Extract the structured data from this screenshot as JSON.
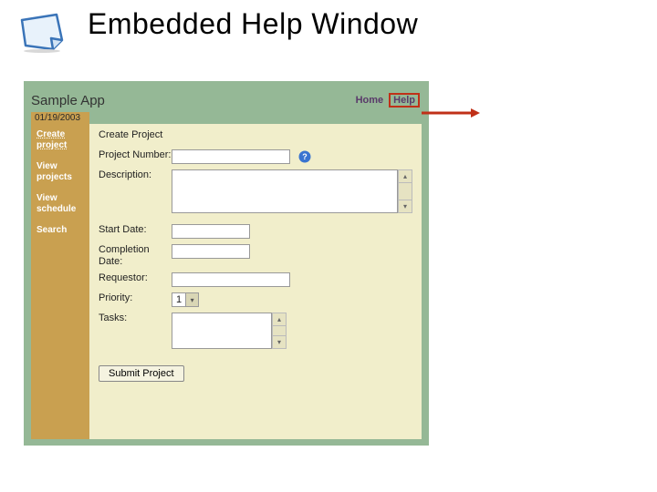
{
  "slide": {
    "title": "Embedded Help Window"
  },
  "app": {
    "name": "Sample App",
    "home_label": "Home",
    "help_label": "Help",
    "date": "01/19/2003"
  },
  "sidebar": {
    "items": [
      {
        "label": "Create project"
      },
      {
        "label": "View projects"
      },
      {
        "label": "View schedule"
      },
      {
        "label": "Search"
      }
    ]
  },
  "main": {
    "heading": "Create Project",
    "fields": {
      "project_number": {
        "label": "Project Number:",
        "value": ""
      },
      "description": {
        "label": "Description:",
        "value": ""
      },
      "start_date": {
        "label": "Start Date:",
        "value": ""
      },
      "completion_date": {
        "label": "Completion Date:",
        "value": ""
      },
      "requestor": {
        "label": "Requestor:",
        "value": ""
      },
      "priority": {
        "label": "Priority:",
        "value": "1"
      },
      "tasks": {
        "label": "Tasks:"
      }
    },
    "submit_label": "Submit Project"
  },
  "icons": {
    "note": "note-icon",
    "help_bubble": "help-bubble-icon",
    "arrow": "callout-arrow"
  }
}
